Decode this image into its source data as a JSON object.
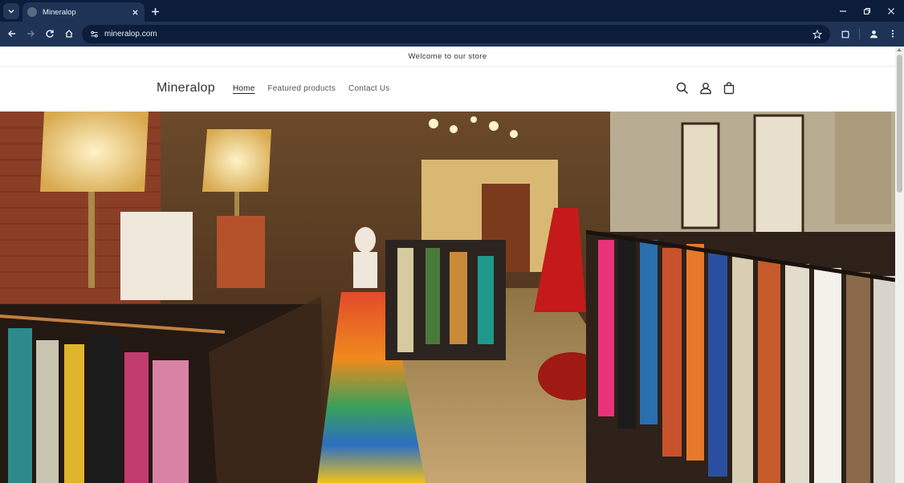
{
  "browser": {
    "tab": {
      "title": "Mineralop"
    },
    "address_bar": {
      "url": "mineralop.com"
    },
    "icons": {
      "tab_search": "chevron-down-icon",
      "close": "close-icon",
      "new_tab": "plus-icon",
      "back": "back-arrow-icon",
      "forward": "forward-arrow-icon",
      "reload": "reload-icon",
      "home": "home-icon",
      "site_info": "site-info-icon",
      "bookmark": "star-icon",
      "extensions": "puzzle-icon",
      "profile": "profile-icon",
      "menu": "kebab-menu-icon"
    }
  },
  "store": {
    "announcement": "Welcome to our store",
    "logo": "Mineralop",
    "nav": [
      {
        "label": "Home",
        "active": true
      },
      {
        "label": "Featured products",
        "active": false
      },
      {
        "label": "Contact Us",
        "active": false
      }
    ],
    "header_icons": [
      "search-icon",
      "account-icon",
      "cart-icon"
    ],
    "hero": {
      "description_only": ""
    }
  },
  "colors": {
    "chrome_dark": "#0b1d3a",
    "chrome_toolbar": "#1f3356",
    "chrome_text": "#e8eef8",
    "page_text": "#333333"
  }
}
